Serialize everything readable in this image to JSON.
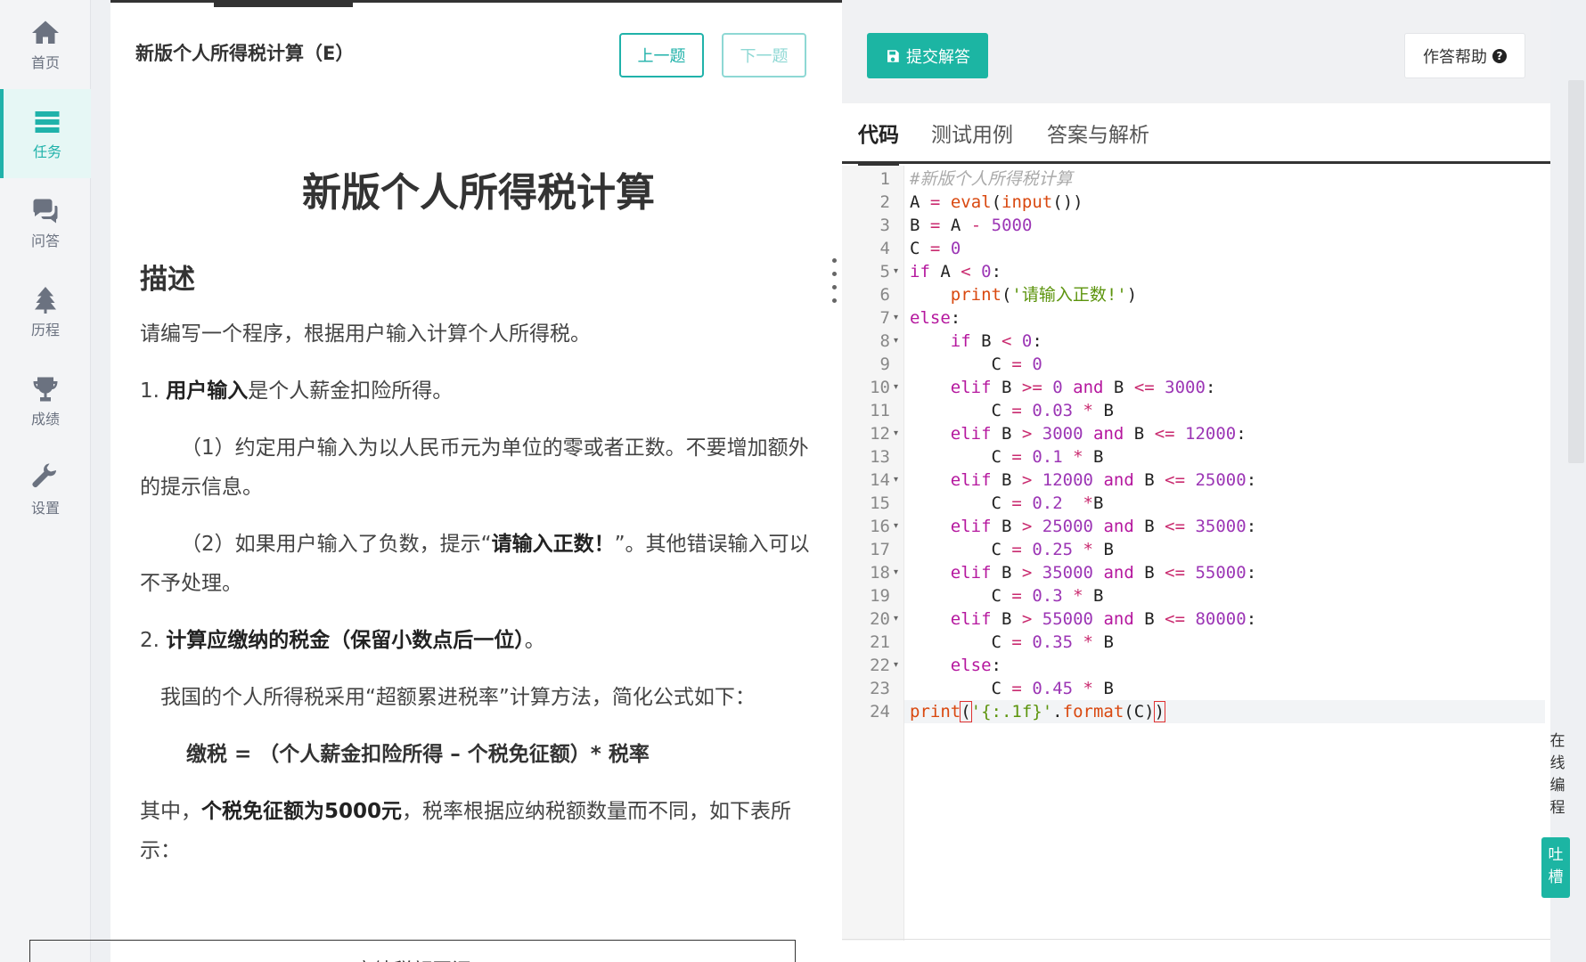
{
  "nav": {
    "items": [
      {
        "label": "首页",
        "icon": "home-icon"
      },
      {
        "label": "任务",
        "icon": "tasks-icon",
        "active": true
      },
      {
        "label": "问答",
        "icon": "chat-icon"
      },
      {
        "label": "历程",
        "icon": "tree-icon"
      },
      {
        "label": "成绩",
        "icon": "trophy-icon"
      },
      {
        "label": "设置",
        "icon": "wrench-icon"
      }
    ]
  },
  "problem": {
    "header_title": "新版个人所得税计算（E）",
    "prev_label": "上一题",
    "next_label": "下一题",
    "title": "新版个人所得税计算",
    "desc_heading": "描述",
    "p1": "请编写一个程序，根据用户输入计算个人所得税。",
    "p2_num": "1. ",
    "p2_bold": "用户输入",
    "p2_rest": "是个人薪金扣险所得。",
    "p3": "（1）约定用户输入为以人民币元为单位的零或者正数。不要增加额外的提示信息。",
    "p4_a": "（2）如果用户输入了负数，提示“",
    "p4_bold": "请输入正数！",
    "p4_b": "”。其他错误输入可以不予处理。",
    "p5_num": "2. ",
    "p5_bold": "计算应缴纳的税金（保留小数点后一位）",
    "p5_rest": "。",
    "p6": "我国的个人所得税采用“超额累进税率”计算方法，简化公式如下：",
    "formula": "缴税 = （个人薪金扣险所得 – 个税免征额）* 税率",
    "p7_a": "其中，",
    "p7_bold": "个税免征额为5000元",
    "p7_b": "，税率根据应纳税额数量而不同，如下表所示：",
    "table_head": "应纳税额区间"
  },
  "editor": {
    "submit_label": "提交解答",
    "help_label": "作答帮助",
    "tabs": [
      "代码",
      "测试用例",
      "答案与解析"
    ],
    "active_tab": 0,
    "line_numbers": [
      "1",
      "2",
      "3",
      "4",
      "5",
      "6",
      "7",
      "8",
      "9",
      "10",
      "11",
      "12",
      "13",
      "14",
      "15",
      "16",
      "17",
      "18",
      "19",
      "20",
      "21",
      "22",
      "23",
      "24"
    ],
    "code": [
      "#新版个人所得税计算",
      "A = eval(input())",
      "B = A - 5000",
      "C = 0",
      "if A < 0:",
      "    print('请输入正数!')",
      "else:",
      "    if B < 0:",
      "        C = 0",
      "    elif B >= 0 and B <= 3000:",
      "        C = 0.03 * B",
      "    elif B > 3000 and B <= 12000:",
      "        C = 0.1 * B",
      "    elif B > 12000 and B <= 25000:",
      "        C = 0.2  *B",
      "    elif B > 25000 and B <= 35000:",
      "        C = 0.25 * B",
      "    elif B > 35000 and B <= 55000:",
      "        C = 0.3 * B",
      "    elif B > 55000 and B <= 80000:",
      "        C = 0.35 * B",
      "    else:",
      "        C = 0.45 * B",
      "print('{:.1f}'.format(C))"
    ],
    "fold_lines": [
      5,
      7,
      8,
      10,
      12,
      14,
      16,
      18,
      20,
      22
    ],
    "current_line": 24
  },
  "side": {
    "online_coding": [
      "在",
      "线",
      "编",
      "程"
    ],
    "feedback": [
      "吐",
      "槽"
    ]
  },
  "colors": {
    "accent": "#1cb5a3"
  }
}
